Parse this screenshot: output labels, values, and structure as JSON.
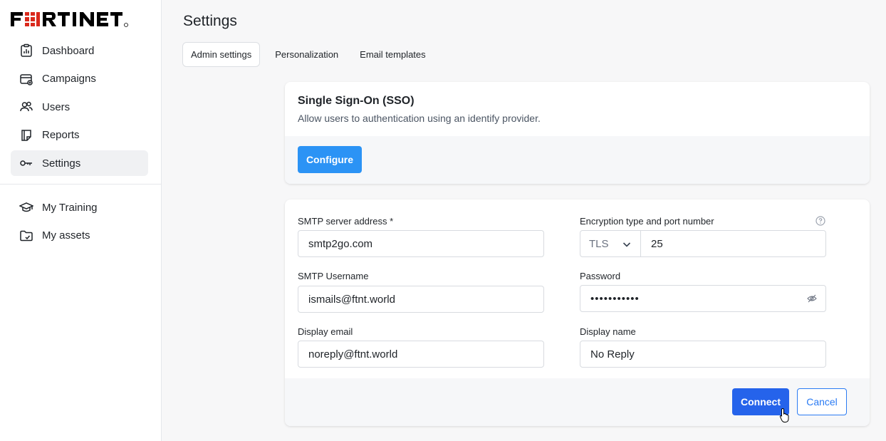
{
  "brand": {
    "logo_text": "FORTINET",
    "registered": "®",
    "accent": "#da291c"
  },
  "sidebar": {
    "items": [
      {
        "label": "Dashboard",
        "icon": "dashboard-icon"
      },
      {
        "label": "Campaigns",
        "icon": "campaigns-icon"
      },
      {
        "label": "Users",
        "icon": "users-icon"
      },
      {
        "label": "Reports",
        "icon": "reports-icon"
      },
      {
        "label": "Settings",
        "icon": "key-icon",
        "active": true
      }
    ],
    "secondary": [
      {
        "label": "My Training",
        "icon": "graduation-cap-icon"
      },
      {
        "label": "My assets",
        "icon": "folder-icon"
      }
    ]
  },
  "page": {
    "title": "Settings",
    "tabs": [
      {
        "label": "Admin settings",
        "active": true
      },
      {
        "label": "Personalization"
      },
      {
        "label": "Email templates"
      }
    ]
  },
  "sso": {
    "title": "Single Sign-On (SSO)",
    "description": "Allow users to authentication using an identify provider.",
    "configure_label": "Configure"
  },
  "smtp": {
    "server_label": "SMTP server address *",
    "server_value": "smtp2go.com",
    "encryption_label": "Encryption type and port number",
    "encryption_value": "TLS",
    "port_value": "25",
    "username_label": "SMTP Username",
    "username_value": "ismails@ftnt.world",
    "password_label": "Password",
    "password_value": "•••••••••••",
    "display_email_label": "Display email",
    "display_email_value": "noreply@ftnt.world",
    "display_name_label": "Display name",
    "display_name_value": "No Reply",
    "connect_label": "Connect",
    "cancel_label": "Cancel"
  },
  "colors": {
    "primary": "#2b93f5",
    "connect": "#2563eb",
    "cancel_border": "#2b7bf3"
  }
}
